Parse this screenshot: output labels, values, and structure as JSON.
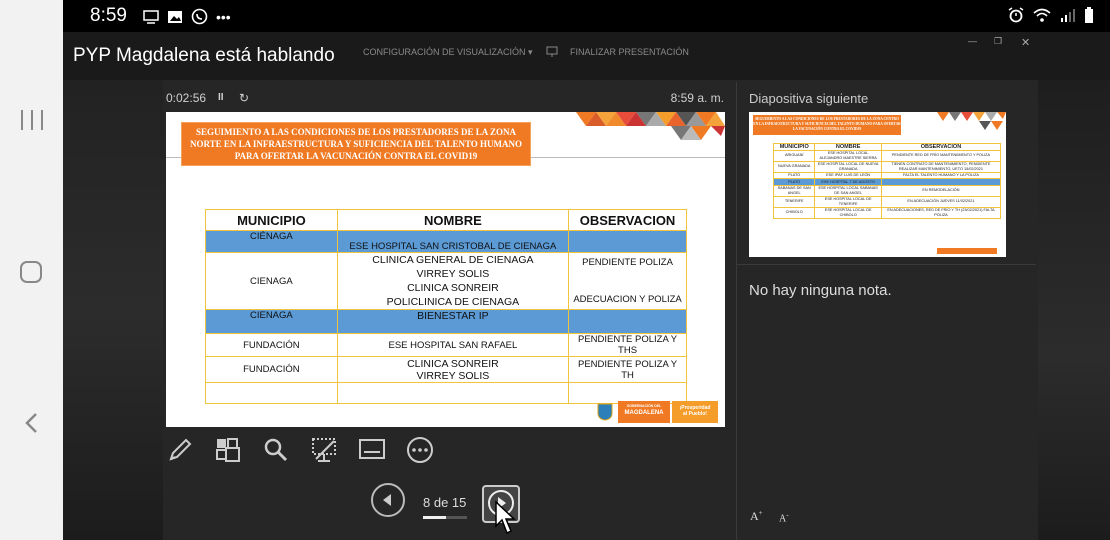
{
  "status_bar": {
    "time": "8:59",
    "more": "•••"
  },
  "title_bar": {
    "speaking": "PYP  Magdalena está hablando",
    "display_settings": "CONFIGURACIÓN DE VISUALIZACIÓN ▾",
    "end_presentation": "FINALIZAR PRESENTACIÓN"
  },
  "presenter": {
    "elapsed": "0:02:56",
    "pause": "II",
    "restart": "↻",
    "clock": "8:59 a. m.",
    "counter": "8 de 15",
    "counter_progress": 0.53
  },
  "slide": {
    "title": "SEGUIMIENTO A LAS CONDICIONES DE LOS PRESTADORES DE LA ZONA NORTE EN LA INFRAESTRUCTURA Y SUFICIENCIA DEL TALENTO HUMANO PARA OFERTAR LA VACUNACIÓN CONTRA EL COVID19",
    "headers": [
      "MUNICIPIO",
      "NOMBRE",
      "OBSERVACION"
    ],
    "rows": [
      {
        "municipio": "CIÉNAGA",
        "nombre": "ESE HOSPITAL SAN CRISTOBAL DE CIENAGA",
        "obs": ""
      },
      {
        "municipio": "CIENAGA",
        "nombre_lines": [
          "CLINICA GENERAL DE CIENAGA",
          "VIRREY SOLIS",
          "CLINICA SONREIR",
          "POLICLINICA DE CIENAGA"
        ],
        "obs_top": "PENDIENTE POLIZA",
        "obs_bottom": "ADECUACION Y POLIZA"
      },
      {
        "municipio": "CIENAGA",
        "nombre": "BIENESTAR IP",
        "obs": ""
      },
      {
        "municipio": "FUNDACIÓN",
        "nombre": "ESE HOSPITAL SAN RAFAEL",
        "obs": "PENDIENTE POLIZA Y THS"
      },
      {
        "municipio": "FUNDACIÓN",
        "nombre_lines": [
          "CLINICA SONREIR",
          "VIRREY SOLIS"
        ],
        "obs": "PENDIENTE POLIZA Y TH"
      }
    ],
    "footer_logo": {
      "line1": "GOBERNACIÓN DEL",
      "line2": "MAGDALENA",
      "badge_line1": "¡Prosperidad",
      "badge_line2": "al Pueblo!"
    }
  },
  "next_slide": {
    "label": "Diapositiva siguiente",
    "title": "SEGUIMIENTO A LAS CONDICIONES DE LOS PRESTADORES DE LA ZONA CENTRO EN LA INFRAESTRUCTURA Y SUFICIENCIA DEL TALENTO HUMANO PARA OFERTAR LA VACUNACIÓN CONTRA EL COVID19",
    "headers": [
      "MUNICIPIO",
      "NOMBRE",
      "OBSERVACION"
    ],
    "rows": [
      [
        "ARIGUANÍ",
        "ESE HOSPITAL LOCAL ALEJANDRO MAESTRE SIERRA",
        "PENDIENTE RED DE FRÍO MANTENIMIENTO Y POLIZA"
      ],
      [
        "NUEVA GRANADA",
        "ESE HOSPITAL LOCAL DE NUEVA GRANADA",
        "TIENEN CONTRATO DE MANTENIMIENTO, PENDIENTE REALIZAR MANTENIMIENTO, UETO 15/02/2021"
      ],
      [
        "PLATO",
        "ESE IPAF LUIS DE LEÓN",
        "FALTA EL TALENTO HUMANO Y LA POLIZA"
      ],
      [
        "PLATO",
        "ESE HOSPITAL 7 DE AGOSTO",
        ""
      ],
      [
        "SABANAS DE SAN ANGEL",
        "ESE HOSPITAL LOCAL SABANAS DE SAN ANGEL",
        "EN REMODELACIÓN"
      ],
      [
        "TENERIFE",
        "ESE HOSPITAL LOCAL DE TENERIFE",
        "EN ADECUACIÓN JUEVES 11/02/2021"
      ],
      [
        "CHIBOLO",
        "ESE HOSPITAL LOCAL DE CHIBOLO",
        "EN ADECUACIONES, RED DE FRÍO Y TH (23/02/2021)     FALTA POLIZA"
      ]
    ]
  },
  "notes": "No hay ninguna nota.",
  "font_controls": {
    "increase": "A",
    "decrease": "A"
  },
  "colors": {
    "accent": "#ef7a23",
    "table_blue": "#5b9ad5",
    "border_gold": "#f0c43c"
  }
}
